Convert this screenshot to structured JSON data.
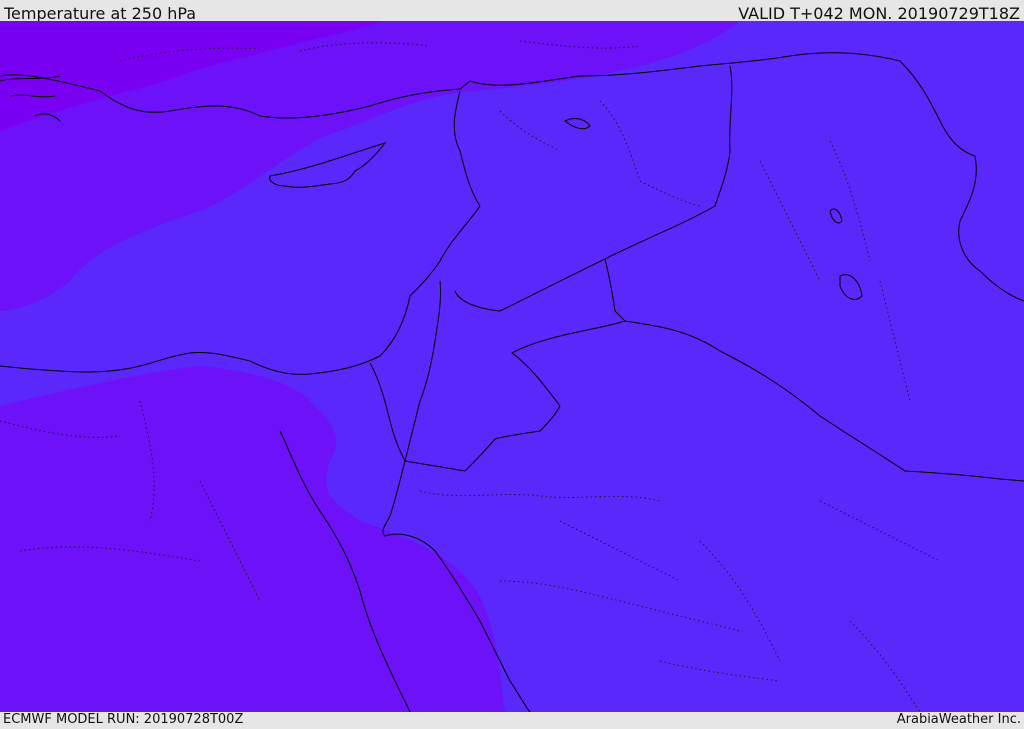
{
  "header": {
    "title": "Temperature at 250 hPa",
    "valid": "VALID T+042 MON. 20190729T18Z"
  },
  "footer": {
    "model_run": "ECMWF MODEL RUN: 20190728T00Z",
    "credit": "ArabiaWeather Inc."
  },
  "map": {
    "colors": {
      "coldest": "#7a00f3",
      "cold": "#6c11f8",
      "base": "#5a28fb"
    }
  }
}
